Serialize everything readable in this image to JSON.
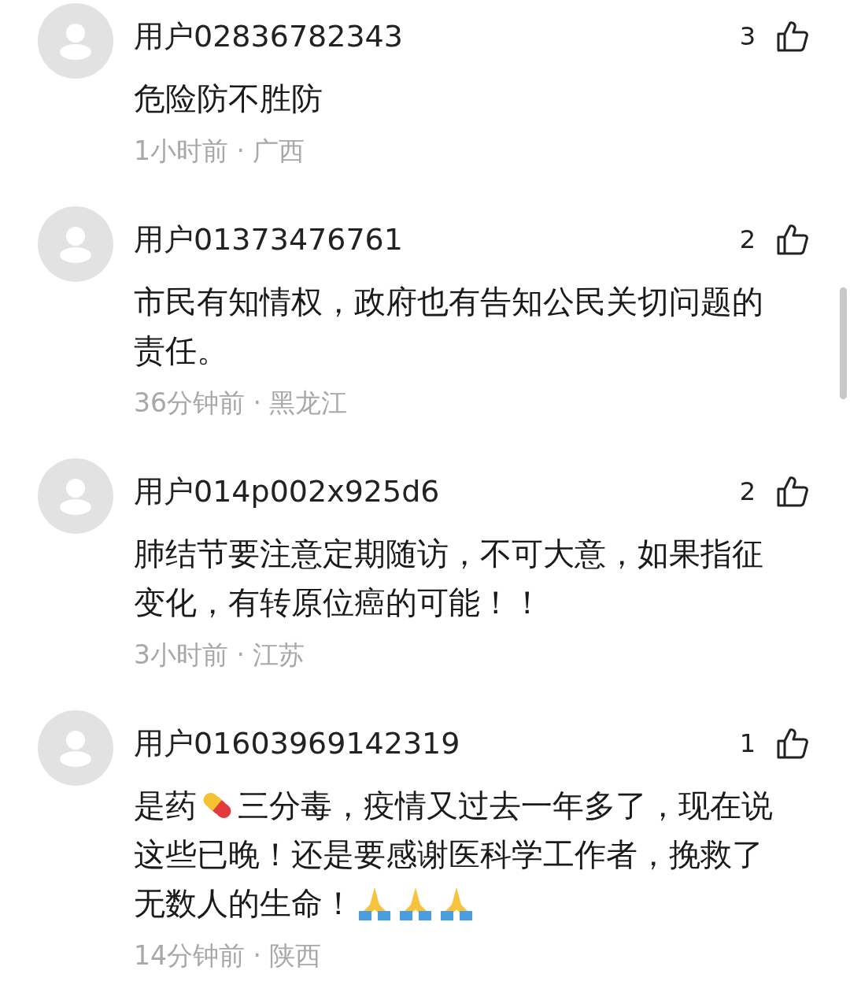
{
  "comments": [
    {
      "username": "用户02836782343",
      "likes": "3",
      "lines": [
        [
          {
            "kind": "text",
            "text": "危险防不胜防"
          }
        ]
      ],
      "meta": "1小时前 · 广西"
    },
    {
      "username": "用户01373476761",
      "likes": "2",
      "lines": [
        [
          {
            "kind": "text",
            "text": "市民有知情权，政府也有告知公民关切问题的"
          }
        ],
        [
          {
            "kind": "text",
            "text": "责任。"
          }
        ]
      ],
      "meta": "36分钟前 · 黑龙江"
    },
    {
      "username": "用户014p002x925d6",
      "likes": "2",
      "lines": [
        [
          {
            "kind": "text",
            "text": "肺结节要注意定期随访，不可大意，如果指征"
          }
        ],
        [
          {
            "kind": "text",
            "text": "变化，有转原位癌的可能！！"
          }
        ]
      ],
      "meta": "3小时前 · 江苏"
    },
    {
      "username": "用户01603969142319",
      "likes": "1",
      "lines": [
        [
          {
            "kind": "text",
            "text": "是药"
          },
          {
            "kind": "pill"
          },
          {
            "kind": "text",
            "text": "三分毒，疫情又过去一年多了，现在说"
          }
        ],
        [
          {
            "kind": "text",
            "text": "这些已晚！还是要感谢医科学工作者，挽救了"
          }
        ],
        [
          {
            "kind": "text",
            "text": "无数人的生命！"
          },
          {
            "kind": "pray"
          },
          {
            "kind": "pray"
          },
          {
            "kind": "pray"
          }
        ]
      ],
      "meta": "14分钟前 · 陕西"
    }
  ]
}
